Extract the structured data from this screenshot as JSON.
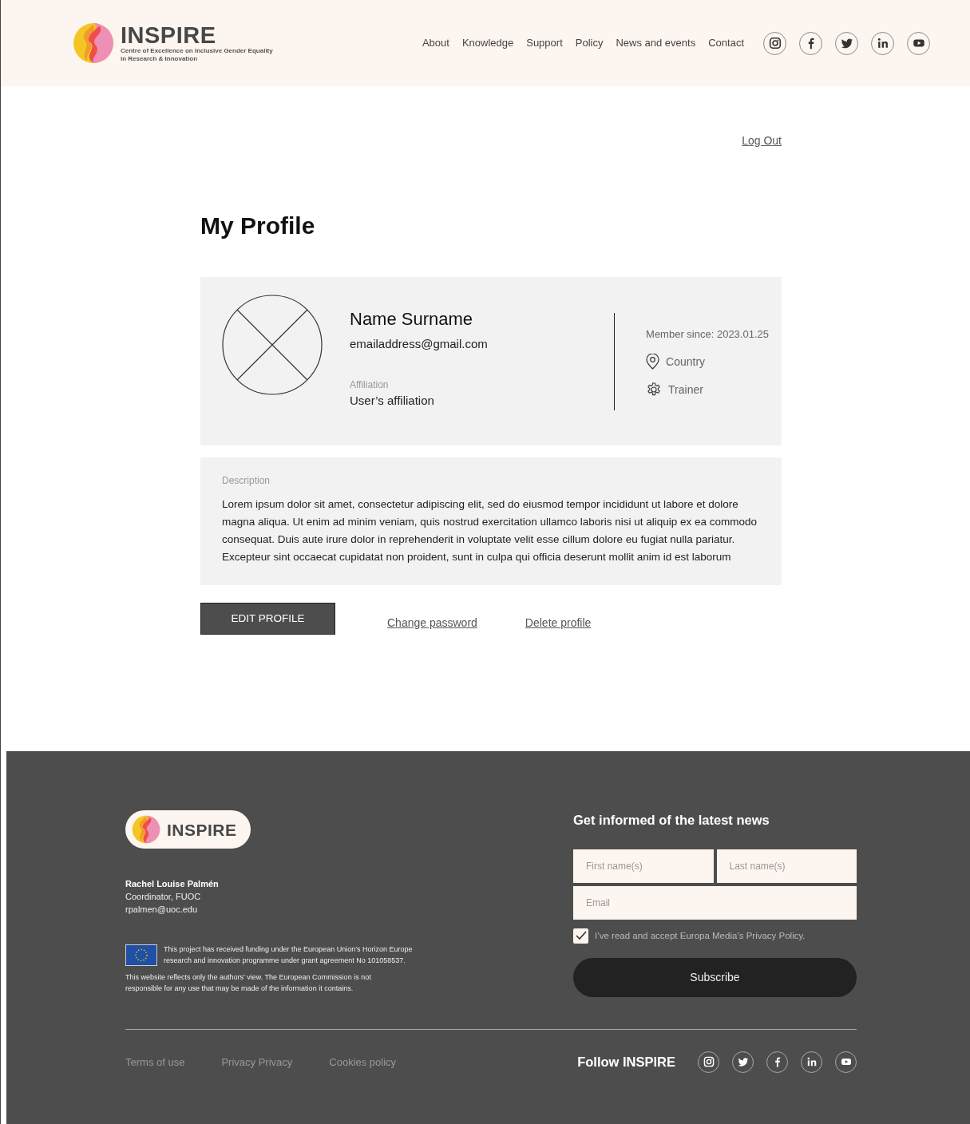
{
  "header": {
    "logo": {
      "name": "INSPIRE",
      "tagline": [
        "Centre of Excellence on Inclusive Gender Equality",
        "in Research & Innovation"
      ]
    },
    "nav": [
      "About",
      "Knowledge",
      "Support",
      "Policy",
      "News and events",
      "Contact"
    ],
    "social": [
      {
        "kind": "instagram"
      },
      {
        "kind": "facebook"
      },
      {
        "kind": "twitter"
      },
      {
        "kind": "linkedin"
      },
      {
        "kind": "youtube"
      }
    ]
  },
  "logout": "Log Out",
  "title": "My Profile",
  "profile": {
    "name": "Name Surname",
    "email": "emailaddress@gmail.com",
    "affiliation_label": "Affiliation",
    "affiliation": "User’s affiliation",
    "member_since": "Member since: 2023.01.25",
    "country": "Country",
    "role": "Trainer"
  },
  "description": {
    "label": "Description",
    "text": "Lorem ipsum dolor sit amet, consectetur adipiscing elit, sed do eiusmod tempor incididunt ut labore et dolore magna aliqua. Ut enim ad minim veniam, quis nostrud exercitation ullamco laboris nisi ut aliquip ex ea commodo consequat. Duis aute irure dolor in reprehenderit in voluptate velit esse cillum dolore eu fugiat nulla pariatur. Excepteur sint occaecat cupidatat non proident, sunt in culpa qui officia deserunt mollit anim id est laborum"
  },
  "actions": {
    "edit": "EDIT PROFILE",
    "change_password": "Change password",
    "delete": "Delete profile"
  },
  "footer": {
    "logo": "INSPIRE",
    "contact": {
      "name": "Rachel Louise Palmén",
      "role": "Coordinator, FUOC",
      "email": "rpalmen@uoc.edu"
    },
    "funding": "This project has received funding under the European Union’s Horizon Europe research and innovation programme under grant agreement No 101058537.",
    "disclaimer": "This website reflects only the authors’ view. The European Commission is not responsible for any use that may be made of the information it contains.",
    "newsletter": {
      "title": "Get informed of the latest news",
      "first_name": {
        "placeholder": "First name(s)"
      },
      "last_name": {
        "placeholder": "Last name(s)"
      },
      "email": {
        "placeholder": "Email"
      },
      "consent": {
        "label": "I’ve read and accept Europa Media’s Privacy Policy.",
        "checked": true
      },
      "button": "Subscribe"
    },
    "links": [
      "Terms of use",
      "Privacy Privacy",
      "Cookies policy"
    ],
    "follow": "Follow INSPIRE",
    "social": [
      {
        "kind": "instagram"
      },
      {
        "kind": "twitter"
      },
      {
        "kind": "facebook"
      },
      {
        "kind": "linkedin"
      },
      {
        "kind": "youtube"
      }
    ]
  }
}
